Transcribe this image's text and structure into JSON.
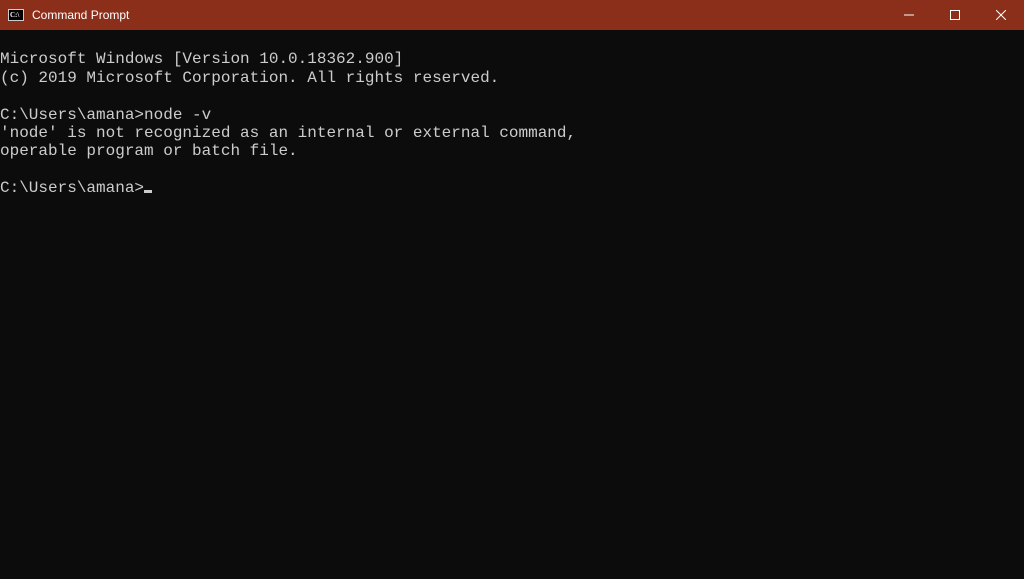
{
  "titlebar": {
    "title": "Command Prompt",
    "icon_label": "cmd-icon"
  },
  "terminal": {
    "line1": "Microsoft Windows [Version 10.0.18362.900]",
    "line2": "(c) 2019 Microsoft Corporation. All rights reserved.",
    "blank1": "",
    "prompt1": "C:\\Users\\amana>",
    "cmd1": "node -v",
    "err1": "'node' is not recognized as an internal or external command,",
    "err2": "operable program or batch file.",
    "blank2": "",
    "prompt2": "C:\\Users\\amana>"
  }
}
